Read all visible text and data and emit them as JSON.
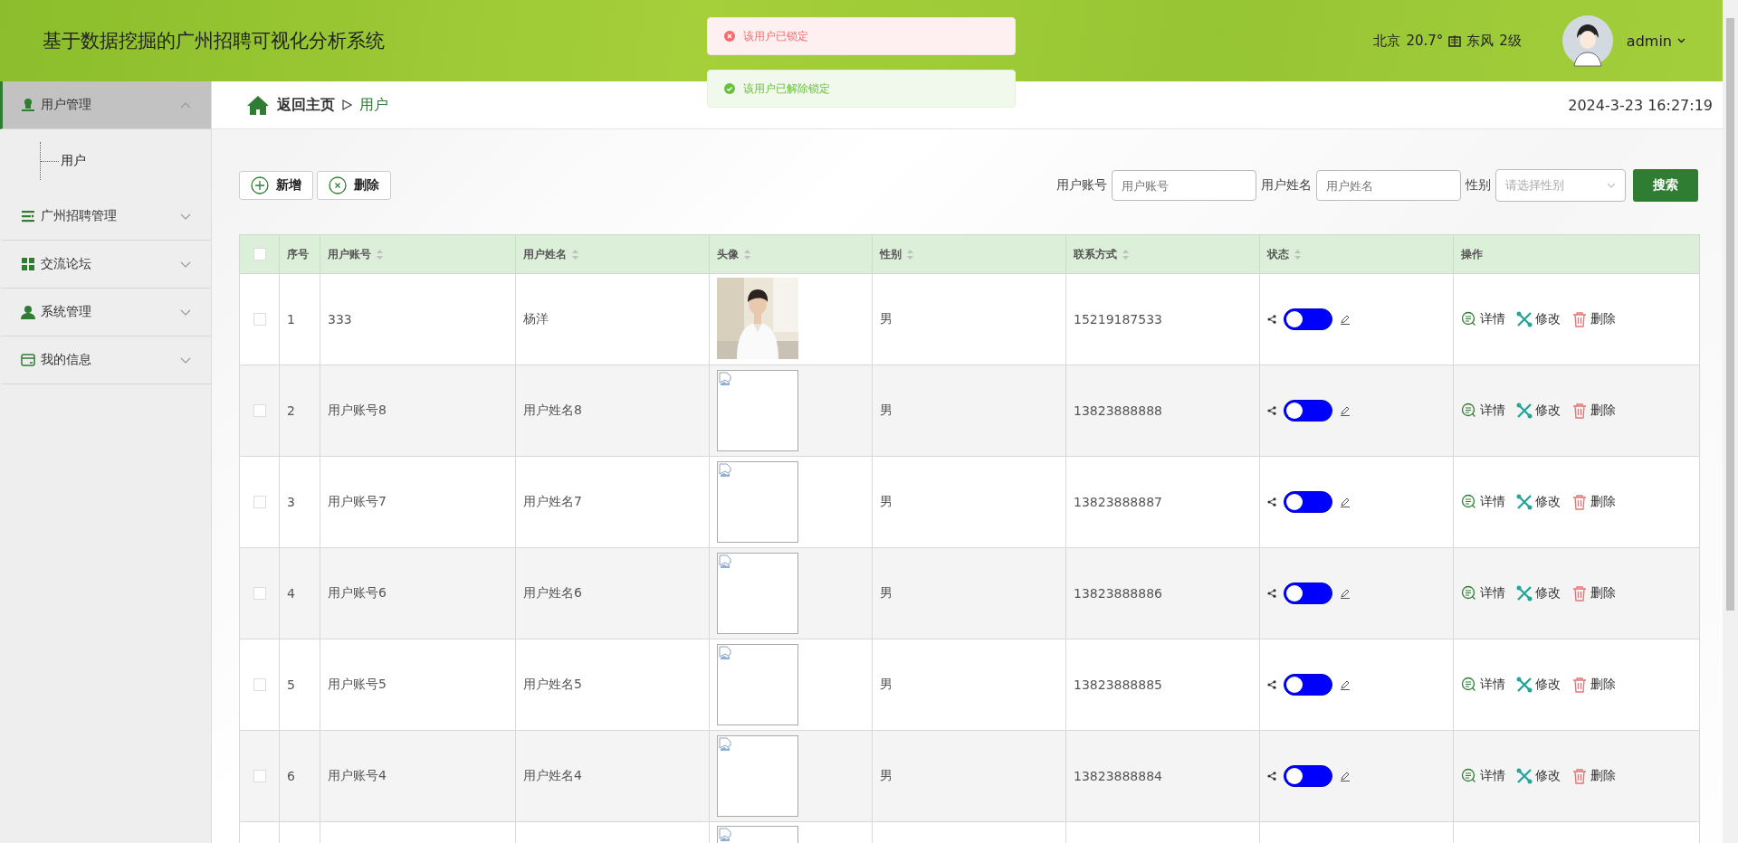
{
  "header": {
    "title": "基于数据挖掘的广州招聘可视化分析系统",
    "weather": {
      "city": "北京",
      "temperature": "20.7°",
      "wind": "东风",
      "wind_level": "2级"
    },
    "user": {
      "name": "admin"
    }
  },
  "toasts": [
    {
      "kind": "error",
      "text": "该用户已锁定"
    },
    {
      "kind": "success",
      "text": "该用户已解除锁定"
    }
  ],
  "sidebar": {
    "items": [
      {
        "label": "用户管理",
        "expanded": true,
        "selected": true,
        "children": [
          {
            "label": "用户"
          }
        ]
      },
      {
        "label": "广州招聘管理",
        "expanded": false,
        "selected": false
      },
      {
        "label": "交流论坛",
        "expanded": false,
        "selected": false
      },
      {
        "label": "系统管理",
        "expanded": false,
        "selected": false
      },
      {
        "label": "我的信息",
        "expanded": false,
        "selected": false
      }
    ]
  },
  "breadcrumb": {
    "home": "返回主页",
    "current": "用户"
  },
  "datetime": "2024-3-23 16:27:19",
  "toolbar": {
    "buttons": [
      {
        "kind": "add",
        "label": "新增"
      },
      {
        "kind": "delete",
        "label": "删除"
      }
    ],
    "filters": [
      {
        "kind": "text",
        "label": "用户账号",
        "placeholder": "用户账号"
      },
      {
        "kind": "text",
        "label": "用户姓名",
        "placeholder": "用户姓名"
      },
      {
        "kind": "select",
        "label": "性别",
        "placeholder": "请选择性别"
      }
    ],
    "search_button": "搜索"
  },
  "table": {
    "header_checked": false,
    "columns": [
      {
        "label": "序号",
        "sortable": false
      },
      {
        "label": "用户账号",
        "sortable": true
      },
      {
        "label": "用户姓名",
        "sortable": true
      },
      {
        "label": "头像",
        "sortable": true
      },
      {
        "label": "性别",
        "sortable": true
      },
      {
        "label": "联系方式",
        "sortable": true
      },
      {
        "label": "状态",
        "sortable": true
      },
      {
        "label": "操作",
        "sortable": false
      }
    ],
    "rows": [
      {
        "checked": false,
        "index": "1",
        "account": "333",
        "name": "杨洋",
        "gender": "男",
        "phone": "15219187533",
        "on": false,
        "actions": [
          "详情",
          "修改",
          "删除"
        ]
      },
      {
        "checked": false,
        "index": "2",
        "account": "用户账号8",
        "name": "用户姓名8",
        "avatar": {
          "kind": "broken"
        },
        "gender": "男",
        "phone": "13823888888",
        "on": false,
        "actions": [
          "详情",
          "修改",
          "删除"
        ]
      },
      {
        "checked": false,
        "index": "3",
        "account": "用户账号7",
        "name": "用户姓名7",
        "avatar": {
          "kind": "broken"
        },
        "gender": "男",
        "phone": "13823888887",
        "on": false,
        "actions": [
          "详情",
          "修改",
          "删除"
        ]
      },
      {
        "checked": false,
        "index": "4",
        "account": "用户账号6",
        "name": "用户姓名6",
        "avatar": {
          "kind": "broken"
        },
        "gender": "男",
        "phone": "13823888886",
        "on": false,
        "actions": [
          "详情",
          "修改",
          "删除"
        ]
      },
      {
        "checked": false,
        "index": "5",
        "account": "用户账号5",
        "name": "用户姓名5",
        "avatar": {
          "kind": "broken"
        },
        "gender": "男",
        "phone": "13823888885",
        "on": false,
        "actions": [
          "详情",
          "修改",
          "删除"
        ]
      },
      {
        "checked": false,
        "index": "6",
        "account": "用户账号4",
        "name": "用户姓名4",
        "avatar": {
          "kind": "broken"
        },
        "gender": "男",
        "phone": "13823888884",
        "on": false,
        "actions": [
          "详情",
          "修改",
          "删除"
        ]
      },
      {
        "avatar": {
          "kind": "broken"
        }
      }
    ]
  }
}
